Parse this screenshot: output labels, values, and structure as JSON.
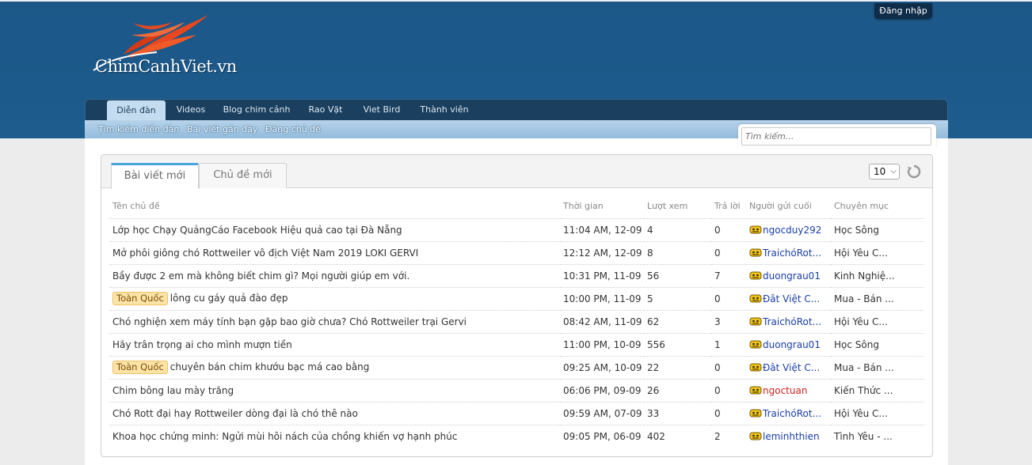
{
  "site": {
    "logo_text": "ChimCanhViet.vn",
    "login_label": "Đăng nhập"
  },
  "nav": {
    "tabs": [
      {
        "label": "Diễn đàn"
      },
      {
        "label": "Videos"
      },
      {
        "label": "Blog chim cảnh"
      },
      {
        "label": "Rao Vặt"
      },
      {
        "label": "Viet Bird"
      },
      {
        "label": "Thành viên"
      }
    ],
    "sub_items": [
      {
        "label": "Tìm kiếm diễn đàn"
      },
      {
        "label": "Bài viết gần đây"
      },
      {
        "label": "Đăng chủ đề"
      }
    ]
  },
  "search": {
    "placeholder": "Tìm kiếm..."
  },
  "panel": {
    "tabs": [
      {
        "label": "Bài viết mới"
      },
      {
        "label": "Chủ đề mới"
      }
    ],
    "per_page": "10",
    "columns": [
      "Tên chủ đề",
      "Thời gian",
      "Lượt xem",
      "Trả lời",
      "Người gửi cuối",
      "Chuyên mục"
    ],
    "rows": [
      {
        "prefix": "",
        "title": "Lớp học Chạy QuảngCáo Facebook Hiệu quả cao tại Đà Nẵng",
        "time": "11:04 AM, 12-09",
        "views": "4",
        "replies": "0",
        "user": "ngocduy292",
        "category": "Học Sông"
      },
      {
        "prefix": "",
        "title": "Mở phôi giông chó Rottweiler vô địch Việt Nam 2019 LOKI GERVI",
        "time": "12:12 AM, 12-09",
        "views": "8",
        "replies": "0",
        "user": "TraichóRot...",
        "category": "Hội Yêu C..."
      },
      {
        "prefix": "",
        "title": "Bầy được 2 em mà không biết chim gì? Mọi người giúp em với.",
        "time": "10:31 PM, 11-09",
        "views": "56",
        "replies": "7",
        "user": "duongrau01",
        "category": "Kinh Nghiệ..."
      },
      {
        "prefix": "Toàn Quốc",
        "title": "lông cu gáy quả đào đẹp",
        "time": "10:00 PM, 11-09",
        "views": "5",
        "replies": "0",
        "user": "Đât Việt C...",
        "category": "Mua - Bán ..."
      },
      {
        "prefix": "",
        "title": "Chó nghiện xem máy tính bạn gặp bao giờ chưa? Chó Rottweiler trại Gervi",
        "time": "08:42 AM, 11-09",
        "views": "62",
        "replies": "3",
        "user": "TraichóRot...",
        "category": "Hội Yêu C..."
      },
      {
        "prefix": "",
        "title": "Hãy trân trọng ai cho mình mượn tiền",
        "time": "11:00 PM, 10-09",
        "views": "556",
        "replies": "1",
        "user": "duongrau01",
        "category": "Học Sông"
      },
      {
        "prefix": "Toàn Quốc",
        "title": "chuyên bán chim khướu bạc má cao bằng",
        "time": "09:25 AM, 10-09",
        "views": "22",
        "replies": "0",
        "user": "Đât Việt C...",
        "category": "Mua - Bán ..."
      },
      {
        "prefix": "",
        "title": "Chim bông lau mày trăng",
        "time": "06:06 PM, 09-09",
        "views": "26",
        "replies": "0",
        "user": "ngoctuan",
        "category": "Kiến Thức ..."
      },
      {
        "prefix": "",
        "title": "Chó Rott đại hay Rottweiler dòng đại là chó thê nào",
        "time": "09:59 AM, 07-09",
        "views": "33",
        "replies": "0",
        "user": "TraichóRot...",
        "category": "Hội Yêu C..."
      },
      {
        "prefix": "",
        "title": "Khoa học chứng minh: Ngửi mùi hôi nách của chồng khiến vợ hạnh phúc",
        "time": "09:05 PM, 06-09",
        "views": "402",
        "replies": "2",
        "user": "leminhthien",
        "category": "Tình Yêu - ..."
      }
    ]
  }
}
